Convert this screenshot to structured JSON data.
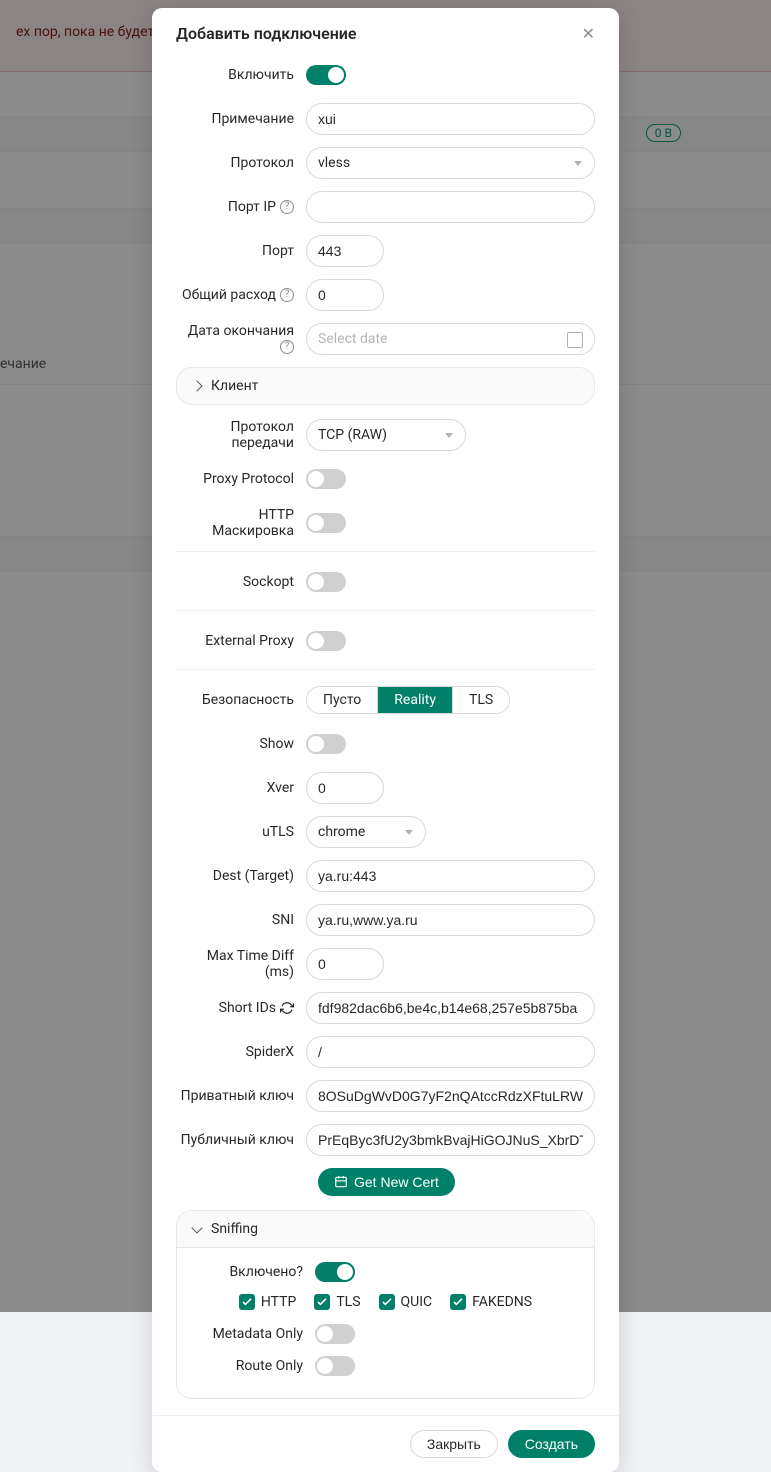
{
  "bg": {
    "alert_text": "ех пор, пока не будет акти",
    "badge": "0 B",
    "sidebar_label": "ечание"
  },
  "modal": {
    "title": "Добавить подключение",
    "labels": {
      "enable": "Включить",
      "remark": "Примечание",
      "protocol": "Протокол",
      "port_ip": "Порт IP",
      "port": "Порт",
      "total_flow": "Общий расход",
      "expiry": "Дата окончания",
      "client": "Клиент",
      "transport": "Протокол передачи",
      "proxy_protocol": "Proxy Protocol",
      "http_masking": "HTTP Маскировка",
      "sockopt": "Sockopt",
      "external_proxy": "External Proxy",
      "security": "Безопасность",
      "show": "Show",
      "xver": "Xver",
      "utls": "uTLS",
      "dest": "Dest (Target)",
      "sni": "SNI",
      "max_time_diff": "Max Time Diff (ms)",
      "short_ids": "Short IDs",
      "spiderx": "SpiderX",
      "private_key": "Приватный ключ",
      "public_key": "Публичный ключ",
      "get_cert": "Get New Cert",
      "sniffing": "Sniffing",
      "sniffing_enabled": "Включено",
      "metadata_only": "Metadata Only",
      "route_only": "Route Only"
    },
    "values": {
      "remark": "xui",
      "protocol": "vless",
      "port": "443",
      "total_flow": "0",
      "expiry_placeholder": "Select date",
      "transport": "TCP (RAW)",
      "xver": "0",
      "utls": "chrome",
      "dest": "ya.ru:443",
      "sni": "ya.ru,www.ya.ru",
      "max_time_diff": "0",
      "short_ids": "fdf982dac6b6,be4c,b14e68,257e5b875ba",
      "spiderx": "/",
      "private_key": "8OSuDgWvD0G7yF2nQAtccRdzXFtuLRW",
      "public_key": "PrEqByc3fU2y3bmkBvajHiGOJNuS_XbrDT"
    },
    "security_options": {
      "none": "Пусто",
      "reality": "Reality",
      "tls": "TLS"
    },
    "sniffing_protocols": {
      "http": "HTTP",
      "tls": "TLS",
      "quic": "QUIC",
      "fakedns": "FAKEDNS"
    },
    "footer": {
      "close": "Закрыть",
      "create": "Создать"
    }
  }
}
